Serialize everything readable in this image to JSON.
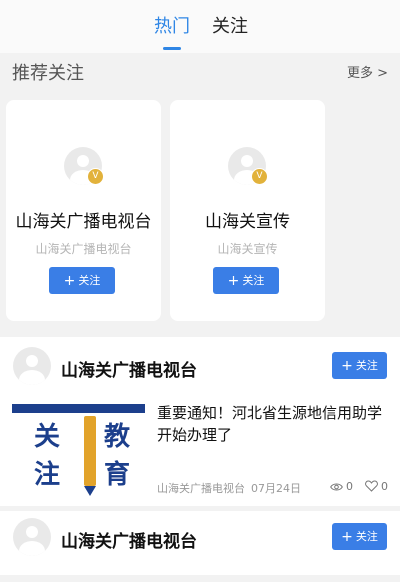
{
  "tabs": [
    {
      "label": "热门",
      "active": true
    },
    {
      "label": "关注",
      "active": false
    }
  ],
  "recommend": {
    "title": "推荐关注",
    "more": "更多 >",
    "cards": [
      {
        "name": "山海关广播电视台",
        "sub": "山海关广播电视台",
        "badge": "V",
        "button": "关注"
      },
      {
        "name": "山海关宣传",
        "sub": "山海关宣传",
        "badge": "V",
        "button": "关注"
      }
    ]
  },
  "feed": [
    {
      "author": "山海关广播电视台",
      "button": "关注",
      "thumb_chars": [
        "关",
        "教",
        "注",
        "育"
      ],
      "headline": "重要通知！河北省生源地信用助学开始办理了",
      "source": "山海关广播电视台",
      "date": "07月24日",
      "views": "0",
      "likes": "0"
    },
    {
      "author": "山海关广播电视台",
      "button": "关注"
    }
  ],
  "colors": {
    "accent": "#2f86e5",
    "button": "#3a7ee6",
    "badge": "#e2b23b",
    "thumb": "#1c3f8c"
  },
  "icons": [
    "avatar-placeholder-icon",
    "verified-badge-icon",
    "plus-icon",
    "eye-icon",
    "heart-icon"
  ]
}
